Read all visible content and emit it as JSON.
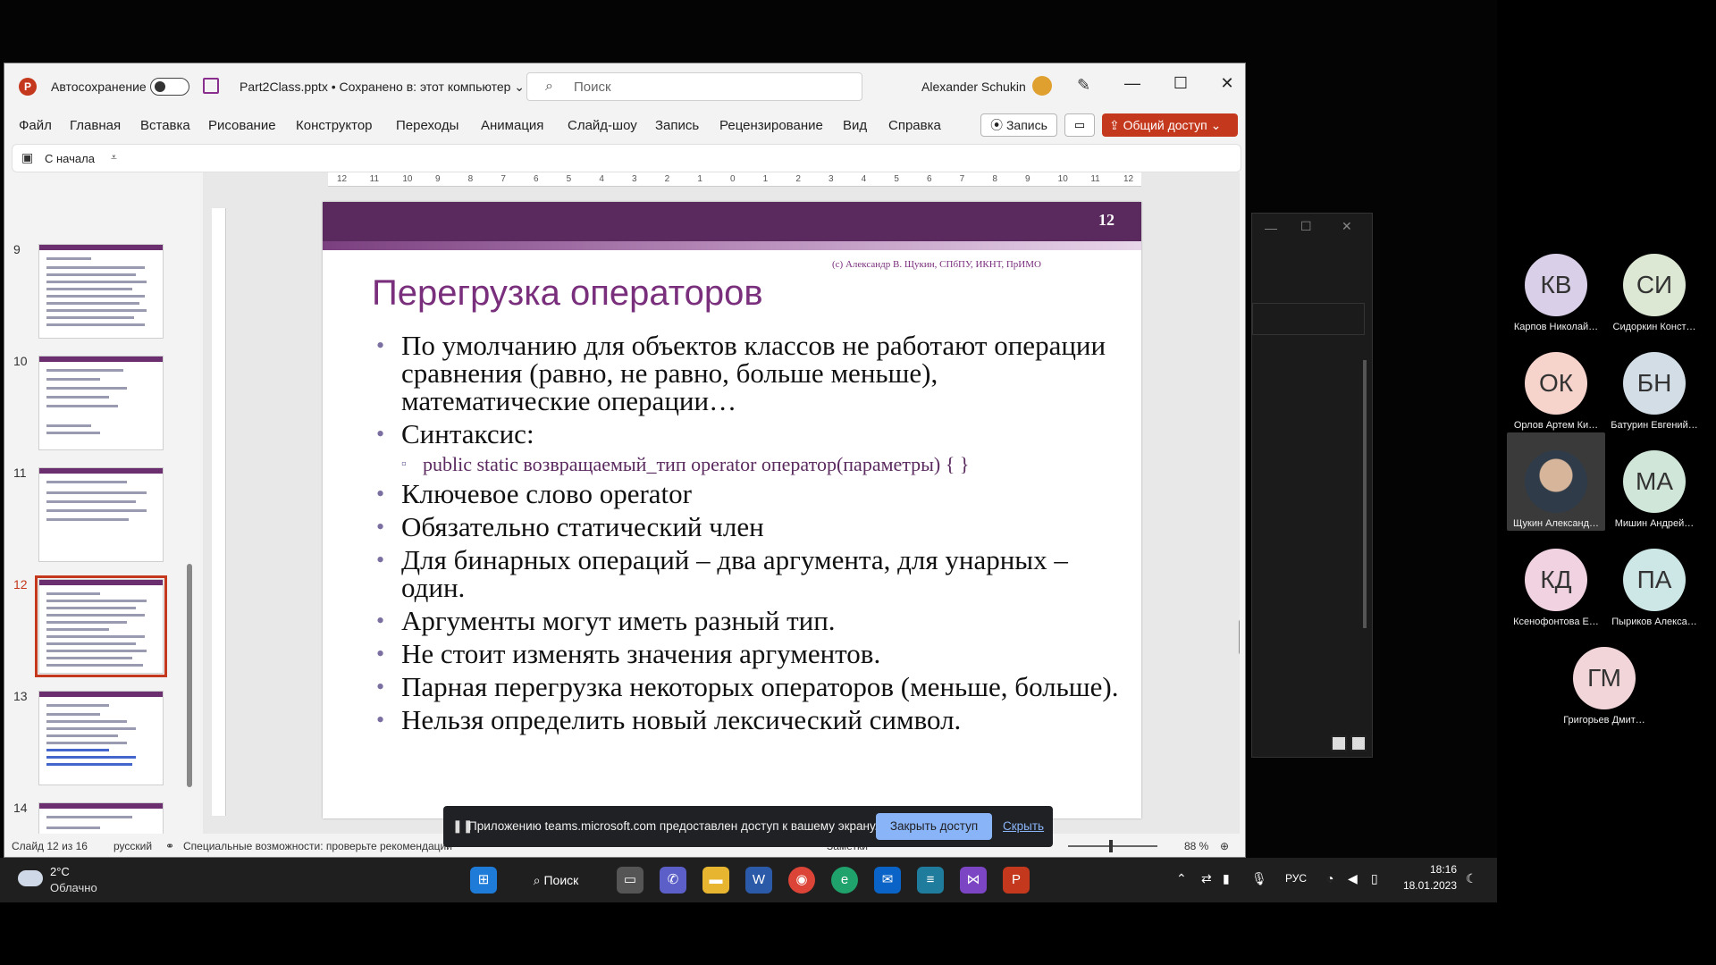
{
  "titlebar": {
    "autosave_label": "Автосохранение",
    "filename": "Part2Class.pptx • Сохранено в: этот компьютер ⌄",
    "search_placeholder": "Поиск",
    "user_name": "Alexander Schukin",
    "minimize": "—",
    "maximize": "☐",
    "close": "✕"
  },
  "menu": {
    "items": [
      "Файл",
      "Главная",
      "Вставка",
      "Рисование",
      "Конструктор",
      "Переходы",
      "Анимация",
      "Слайд-шоу",
      "Запись",
      "Рецензирование",
      "Вид",
      "Справка"
    ],
    "record_button": "⦿ Запись",
    "comments_icon": "▭",
    "share_button": "⇪ Общий доступ ⌄"
  },
  "qat": {
    "from_start": "С начала"
  },
  "thumbnails": {
    "numbers": [
      "9",
      "10",
      "11",
      "12",
      "13",
      "14"
    ],
    "selected": "12"
  },
  "ruler": {
    "h_ticks": [
      "12",
      "11",
      "10",
      "9",
      "8",
      "7",
      "6",
      "5",
      "4",
      "3",
      "2",
      "1",
      "0",
      "1",
      "2",
      "3",
      "4",
      "5",
      "6",
      "7",
      "8",
      "9",
      "10",
      "11",
      "12"
    ]
  },
  "slide": {
    "number": "12",
    "credit": "(c) Александр В. Щукин, СПбПУ, ИКНТ, ПрИМО",
    "title": "Перегрузка операторов",
    "bullets": [
      {
        "level": 1,
        "text": "По умолчанию для объектов классов не работают операции сравнения (равно, не равно, больше меньше), математические операции…"
      },
      {
        "level": 1,
        "text": "Синтаксис:"
      },
      {
        "level": 2,
        "text": "public static возвращаемый_тип operator оператор(параметры) { }"
      },
      {
        "level": 1,
        "text": "Ключевое слово operator"
      },
      {
        "level": 1,
        "text": "Обязательно статический член"
      },
      {
        "level": 1,
        "text": "Для бинарных операций – два аргумента, для унарных – один."
      },
      {
        "level": 1,
        "text": "Аргументы могут иметь разный тип."
      },
      {
        "level": 1,
        "text": "Не стоит изменять значения аргументов."
      },
      {
        "level": 1,
        "text": "Парная перегрузка некоторых операторов (меньше, больше)."
      },
      {
        "level": 1,
        "text": "Нельзя определить новый лексический символ."
      }
    ]
  },
  "notification": {
    "text": "Приложению teams.microsoft.com предоставлен доступ к вашему экрану.",
    "stop_button": "Закрыть доступ",
    "hide_link": "Скрыть"
  },
  "statusbar": {
    "slide_counter": "Слайд 12 из 16",
    "language": "русский",
    "accessibility": "Специальные возможности: проверьте рекомендации",
    "notes": "Заметки",
    "zoom": "88 %"
  },
  "participants": [
    {
      "initials": "КВ",
      "name": "Карпов Николай…",
      "color": "#d9cfe8"
    },
    {
      "initials": "СИ",
      "name": "Сидоркин Конст…",
      "color": "#dce8d4"
    },
    {
      "initials": "ОК",
      "name": "Орлов Артем Ки…",
      "color": "#f6d4cc"
    },
    {
      "initials": "БН",
      "name": "Батурин Евгений…",
      "color": "#d2dde6"
    },
    {
      "initials": "",
      "name": "Щукин Александ…",
      "color": "#4a5a6a"
    },
    {
      "initials": "МА",
      "name": "Мишин Андрей…",
      "color": "#cfe6d9"
    },
    {
      "initials": "КД",
      "name": "Ксенофонтова Е…",
      "color": "#f0d2e0"
    },
    {
      "initials": "ПА",
      "name": "Пыриков Алекса…",
      "color": "#cde7e6"
    },
    {
      "initials": "ГМ",
      "name": "Григорьев Дмит…",
      "color": "#f2d5d9"
    }
  ],
  "taskbar": {
    "weather_temp": "2°C",
    "weather_desc": "Облачно",
    "search_label": "⌕ Поиск",
    "lang": "РУС",
    "time": "18:16",
    "date": "18.01.2023"
  },
  "colors": {
    "slide_accent": "#5a2a5f",
    "title_color": "#7a2f7d",
    "share_button": "#c4391d"
  }
}
